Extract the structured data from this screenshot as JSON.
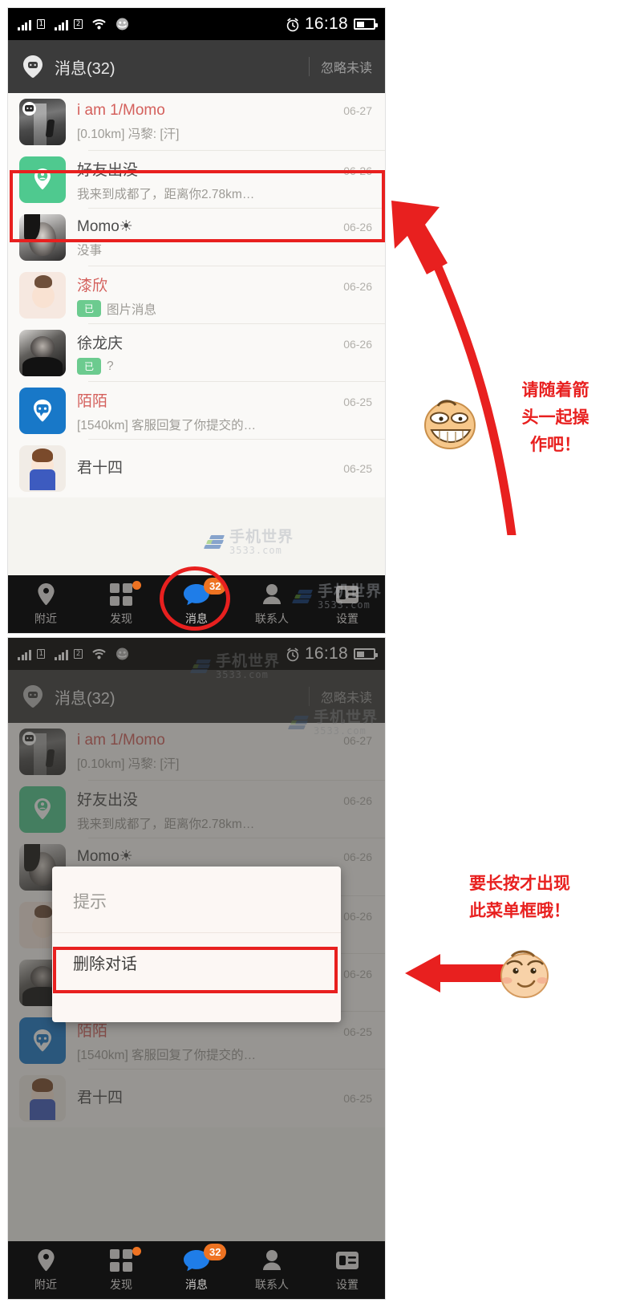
{
  "statusbar": {
    "time": "16:18",
    "sim1_label": "1",
    "sim2_label": "2",
    "icons": [
      "signal-1-icon",
      "signal-2-icon",
      "wifi-icon",
      "contacts-sync-icon",
      "alarm-icon",
      "battery-icon"
    ]
  },
  "titlebar": {
    "title": "消息(32)",
    "action": "忽略未读"
  },
  "chats": [
    {
      "name": "i am 1/Momo",
      "name_color": "red",
      "date": "06-27",
      "message": "[0.10km] 冯黎: [汗]",
      "read_badge": "",
      "avatar": "av-alley"
    },
    {
      "name": "好友出没",
      "name_color": "dark",
      "date": "06-26",
      "message": "我来到成都了，距离你2.78km…",
      "read_badge": "",
      "avatar": "av-green"
    },
    {
      "name": "Momo☀",
      "name_color": "dark",
      "date": "06-26",
      "message": "没事",
      "read_badge": "",
      "avatar": "av-girl"
    },
    {
      "name": "漆欣",
      "name_color": "red",
      "date": "06-26",
      "message": "图片消息",
      "read_badge": "已",
      "avatar": "av-cartoon"
    },
    {
      "name": "徐龙庆",
      "name_color": "dark",
      "date": "06-26",
      "message": "?",
      "read_badge": "已",
      "avatar": "av-man"
    },
    {
      "name": "陌陌",
      "name_color": "red",
      "date": "06-25",
      "message": "[1540km] 客服回复了你提交的…",
      "read_badge": "",
      "avatar": "av-blue"
    },
    {
      "name": "君十四",
      "name_color": "dark",
      "date": "06-25",
      "message": "",
      "read_badge": "",
      "avatar": "av-anime"
    }
  ],
  "bottomnav": {
    "items": [
      {
        "label": "附近",
        "icon": "location-pin-icon",
        "badge": "",
        "dot": false,
        "active": false
      },
      {
        "label": "发现",
        "icon": "grid-apps-icon",
        "badge": "",
        "dot": true,
        "active": false
      },
      {
        "label": "消息",
        "icon": "chat-bubble-icon",
        "badge": "32",
        "dot": false,
        "active": true
      },
      {
        "label": "联系人",
        "icon": "person-icon",
        "badge": "",
        "dot": false,
        "active": false
      },
      {
        "label": "设置",
        "icon": "settings-card-icon",
        "badge": "",
        "dot": false,
        "active": false
      }
    ]
  },
  "dialog": {
    "title": "提示",
    "item": "删除对话"
  },
  "annotations": {
    "first": {
      "lines": [
        "请随着箭",
        "头一起操",
        "作吧！"
      ],
      "arrow": "curved-arrow-up-left",
      "face": "grinning-face"
    },
    "second": {
      "lines": [
        "要长按才出现",
        "此菜单框哦！"
      ],
      "arrow": "straight-arrow-left",
      "face": "smirking-face"
    }
  },
  "watermark": {
    "text_cn": "手机世界",
    "text_en": "3533.com"
  },
  "colors": {
    "accent_red": "#e8201f",
    "badge_orange": "#ee7322",
    "green": "#4fc98f",
    "blue": "#1878c8",
    "statusbar_bg": "#000000",
    "titlebar_bg": "#3b3b3b",
    "nav_bg": "#121212",
    "list_bg": "#faf9f7"
  }
}
